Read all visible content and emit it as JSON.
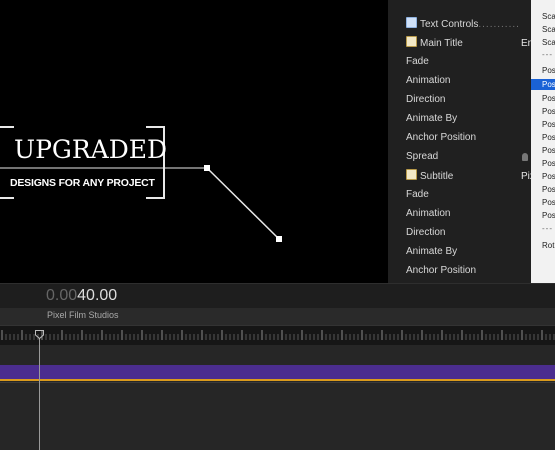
{
  "viewer": {
    "title_main": "UPGRADED",
    "title_sub": "DESIGNS FOR ANY PROJECT"
  },
  "inspector": {
    "rows": [
      {
        "label": "Text Controls",
        "type": "group-checked"
      },
      {
        "label": "Main Title",
        "type": "group-note",
        "value": "En"
      },
      {
        "label": "Fade"
      },
      {
        "label": "Animation"
      },
      {
        "label": "Direction"
      },
      {
        "label": "Animate By"
      },
      {
        "label": "Anchor Position"
      },
      {
        "label": "Spread"
      },
      {
        "label": "Subtitle",
        "type": "group-note",
        "value": "Pix"
      },
      {
        "label": "Fade"
      },
      {
        "label": "Animation"
      },
      {
        "label": "Direction"
      },
      {
        "label": "Animate By"
      },
      {
        "label": "Anchor Position"
      }
    ]
  },
  "popup_menu": {
    "items": [
      "Sca",
      "Sca",
      "Sca",
      "---",
      "Pos",
      "Pos",
      "Pos",
      "Pos",
      "Pos",
      "Pos",
      "Pos",
      "Pos",
      "Pos",
      "Pos",
      "Pos",
      "Pos",
      "---",
      "Rot"
    ],
    "selected_index": 5
  },
  "timeline": {
    "timecode_dim": "0.00",
    "timecode_bright": "40.00",
    "project_name": "Pixel Film Studios"
  },
  "colors": {
    "clip": "#4b2d8f",
    "clip_border": "#d99a1c",
    "menu_selected": "#1a62d6"
  }
}
